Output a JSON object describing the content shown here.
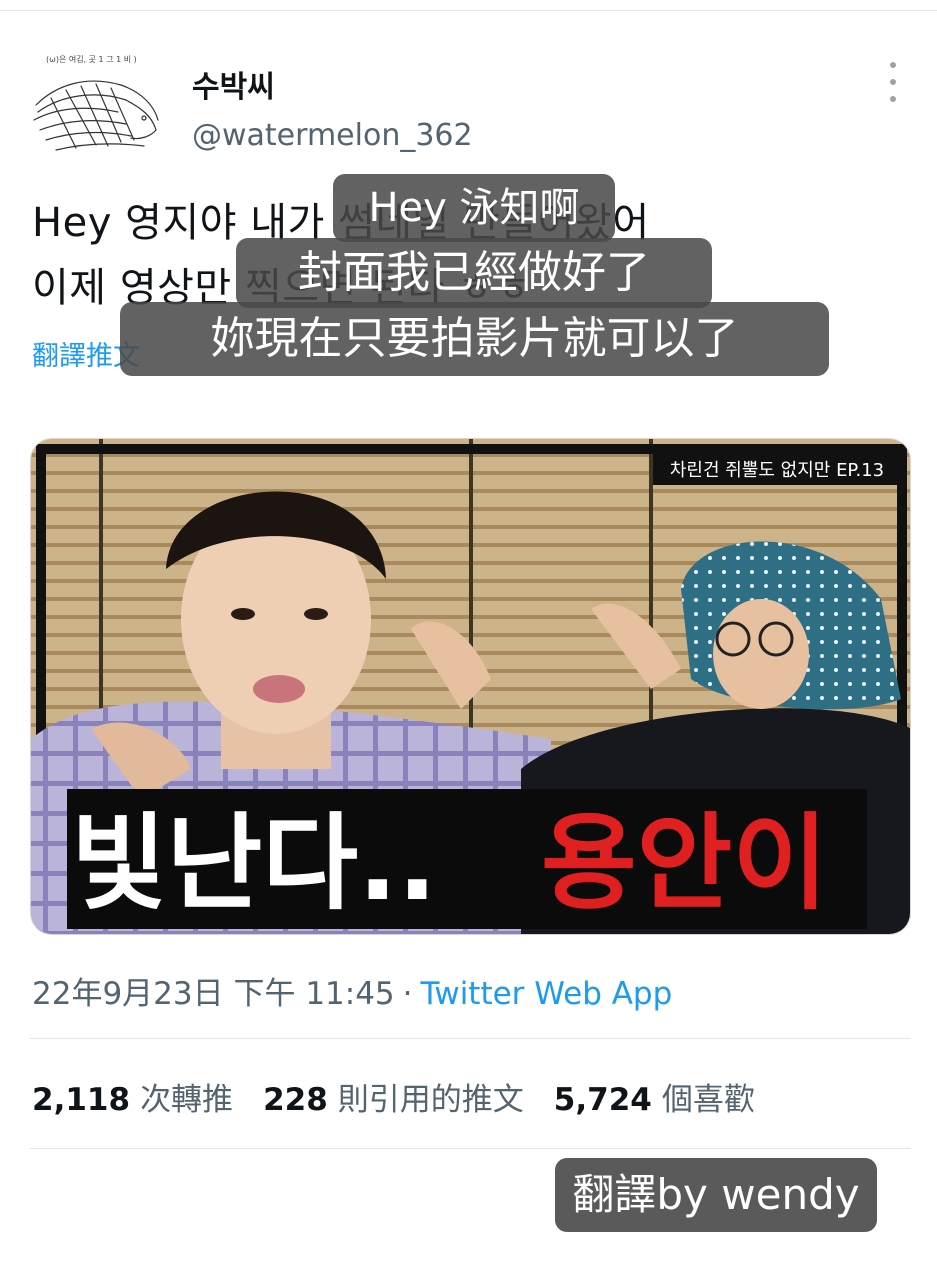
{
  "user": {
    "display_name": "수박씨",
    "handle": "@watermelon_362",
    "avatar_caption": "(ω)은 여김, 곳 1 그 1 비 )"
  },
  "tweet": {
    "line1": "Hey 영지야 내가 썸네일 만들어왔어",
    "line2": "이제 영상만 찍으면 된다 ㅎㅎ",
    "translate_link": "翻譯推文"
  },
  "subtitles": {
    "s1": "Hey 泳知啊",
    "s2": "封面我已經做好了",
    "s3": "妳現在只要拍影片就可以了"
  },
  "media": {
    "episode_tag": "차린건 쥐뿔도 없지만 EP.13",
    "caption_white": "빛난다..",
    "caption_red": "용안이"
  },
  "meta": {
    "timestamp": "22年9月23日 下午 11:45",
    "separator": "·",
    "source": "Twitter Web App"
  },
  "stats": {
    "retweets_count": "2,118",
    "retweets_label": "次轉推",
    "quotes_count": "228",
    "quotes_label": "則引用的推文",
    "likes_count": "5,724",
    "likes_label": "個喜歡"
  },
  "credit": "翻譯by wendy"
}
